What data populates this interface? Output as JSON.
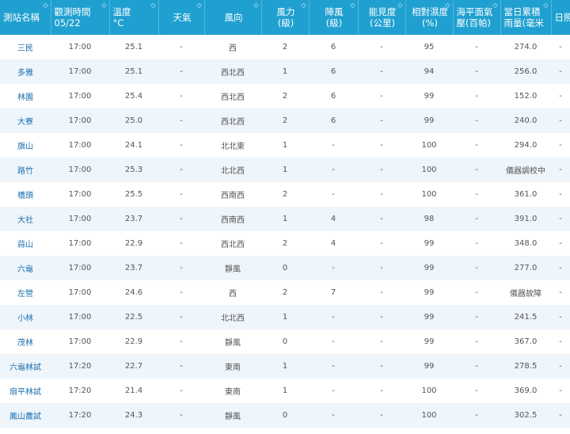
{
  "headers": [
    {
      "line1": "測站名稱",
      "line2": ""
    },
    {
      "line1": "觀測時間",
      "line2": "05/22"
    },
    {
      "line1": "溫度",
      "line2": "°C"
    },
    {
      "line1": "天氣",
      "line2": ""
    },
    {
      "line1": "風向",
      "line2": ""
    },
    {
      "line1": "風力",
      "line2": "(級)"
    },
    {
      "line1": "陣風",
      "line2": "(級)"
    },
    {
      "line1": "能見度",
      "line2": "(公里)"
    },
    {
      "line1": "相對濕度",
      "line2": "(%)"
    },
    {
      "line1": "海平面氣",
      "line2": "壓(百帕)"
    },
    {
      "line1": "當日累積",
      "line2": "雨量(毫米"
    },
    {
      "line1": "日照時",
      "line2": ""
    }
  ],
  "rows": [
    [
      "三民",
      "17:00",
      "25.1",
      "-",
      "西",
      "2",
      "6",
      "-",
      "95",
      "-",
      "274.0",
      "-"
    ],
    [
      "多雅",
      "17:00",
      "25.1",
      "-",
      "西北西",
      "1",
      "6",
      "-",
      "94",
      "-",
      "256.0",
      "-"
    ],
    [
      "林園",
      "17:00",
      "25.4",
      "-",
      "西北西",
      "2",
      "6",
      "-",
      "99",
      "-",
      "152.0",
      "-"
    ],
    [
      "大寮",
      "17:00",
      "25.0",
      "-",
      "西北西",
      "2",
      "6",
      "-",
      "99",
      "-",
      "240.0",
      "-"
    ],
    [
      "旗山",
      "17:00",
      "24.1",
      "-",
      "北北東",
      "1",
      "-",
      "-",
      "100",
      "-",
      "294.0",
      "-"
    ],
    [
      "路竹",
      "17:00",
      "25.3",
      "-",
      "北北西",
      "1",
      "-",
      "-",
      "100",
      "-",
      "儀器調校中",
      "-"
    ],
    [
      "橋頭",
      "17:00",
      "25.5",
      "-",
      "西南西",
      "2",
      "-",
      "-",
      "100",
      "-",
      "361.0",
      "-"
    ],
    [
      "大社",
      "17:00",
      "23.7",
      "-",
      "西南西",
      "1",
      "4",
      "-",
      "98",
      "-",
      "391.0",
      "-"
    ],
    [
      "蒜山",
      "17:00",
      "22.9",
      "-",
      "西北西",
      "2",
      "4",
      "-",
      "99",
      "-",
      "348.0",
      "-"
    ],
    [
      "六龜",
      "17:00",
      "23.7",
      "-",
      "靜風",
      "0",
      "-",
      "-",
      "99",
      "-",
      "277.0",
      "-"
    ],
    [
      "左營",
      "17:00",
      "24.6",
      "-",
      "西",
      "2",
      "7",
      "-",
      "99",
      "-",
      "儀器故障",
      "-"
    ],
    [
      "小林",
      "17:00",
      "22.5",
      "-",
      "北北西",
      "1",
      "-",
      "-",
      "99",
      "-",
      "241.5",
      "-"
    ],
    [
      "茂林",
      "17:00",
      "22.9",
      "-",
      "靜風",
      "0",
      "-",
      "-",
      "99",
      "-",
      "367.0",
      "-"
    ],
    [
      "六龜林試",
      "17:20",
      "22.7",
      "-",
      "東南",
      "1",
      "-",
      "-",
      "99",
      "-",
      "278.5",
      "-"
    ],
    [
      "扇平林試",
      "17:20",
      "21.4",
      "-",
      "東南",
      "1",
      "-",
      "-",
      "100",
      "-",
      "369.0",
      "-"
    ],
    [
      "鳳山農試",
      "17:20",
      "24.3",
      "-",
      "靜風",
      "0",
      "-",
      "-",
      "100",
      "-",
      "302.5",
      "-"
    ]
  ],
  "sort_glyph": "◇",
  "colors": {
    "header_bg": "#20a0d0",
    "station_link": "#1a6fb0",
    "row_alt": "#eef5fb"
  }
}
